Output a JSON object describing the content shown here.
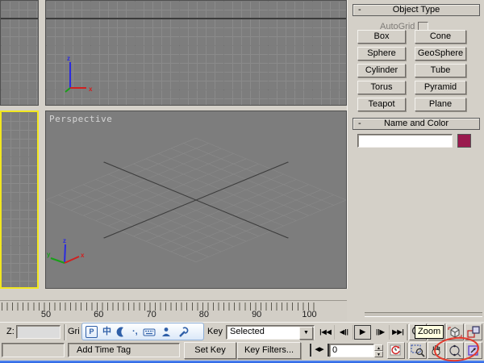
{
  "colors": {
    "active_viewport_border": "#f2e71f",
    "annotation_red": "#e23b2e",
    "taskbar_blue": "#2a63e0"
  },
  "viewports": {
    "perspective_label": "Perspective",
    "axis": {
      "x": "x",
      "y": "y",
      "z": "z"
    }
  },
  "command_panel": {
    "object_type": {
      "collapse": "-",
      "title": "Object Type",
      "autogrid_label": "AutoGrid",
      "buttons": [
        "Box",
        "Cone",
        "Sphere",
        "GeoSphere",
        "Cylinder",
        "Tube",
        "Torus",
        "Pyramid",
        "Teapot",
        "Plane"
      ]
    },
    "name_and_color": {
      "collapse": "-",
      "title": "Name and Color",
      "name_value": "",
      "color_swatch": "#9a1a4e"
    }
  },
  "trackbar": {
    "labels": [
      "50",
      "60",
      "70",
      "80",
      "90",
      "100"
    ]
  },
  "status": {
    "z_label": "Z:",
    "z_value": "",
    "grid_text": "Gri",
    "key_label": "Key",
    "selected": "Selected",
    "add_time_tag": "Add Time Tag",
    "set_key": "Set Key",
    "key_filters": "Key Filters...",
    "frame_value": "0"
  },
  "playback": {
    "go_start": "|◀◀",
    "prev": "◀||",
    "play": "▶",
    "next": "||▶",
    "go_end": "▶▶|"
  },
  "tooltip": {
    "text": "Zoom"
  },
  "ime": {
    "logo": "P",
    "mode": "中",
    "punct": "·,"
  },
  "icons": {
    "dropdown_arrow": "▼",
    "spinner_up": "▲",
    "spinner_down": "▼",
    "key_mode": "◀▶"
  }
}
